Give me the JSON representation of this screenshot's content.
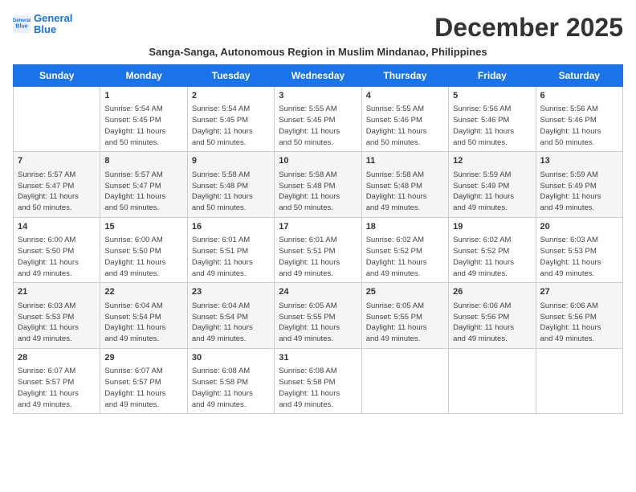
{
  "logo": {
    "text_general": "General",
    "text_blue": "Blue"
  },
  "title": "December 2025",
  "subtitle": "Sanga-Sanga, Autonomous Region in Muslim Mindanao, Philippines",
  "weekdays": [
    "Sunday",
    "Monday",
    "Tuesday",
    "Wednesday",
    "Thursday",
    "Friday",
    "Saturday"
  ],
  "weeks": [
    [
      {
        "day": "",
        "info": ""
      },
      {
        "day": "1",
        "info": "Sunrise: 5:54 AM\nSunset: 5:45 PM\nDaylight: 11 hours\nand 50 minutes."
      },
      {
        "day": "2",
        "info": "Sunrise: 5:54 AM\nSunset: 5:45 PM\nDaylight: 11 hours\nand 50 minutes."
      },
      {
        "day": "3",
        "info": "Sunrise: 5:55 AM\nSunset: 5:45 PM\nDaylight: 11 hours\nand 50 minutes."
      },
      {
        "day": "4",
        "info": "Sunrise: 5:55 AM\nSunset: 5:46 PM\nDaylight: 11 hours\nand 50 minutes."
      },
      {
        "day": "5",
        "info": "Sunrise: 5:56 AM\nSunset: 5:46 PM\nDaylight: 11 hours\nand 50 minutes."
      },
      {
        "day": "6",
        "info": "Sunrise: 5:56 AM\nSunset: 5:46 PM\nDaylight: 11 hours\nand 50 minutes."
      }
    ],
    [
      {
        "day": "7",
        "info": "Sunrise: 5:57 AM\nSunset: 5:47 PM\nDaylight: 11 hours\nand 50 minutes."
      },
      {
        "day": "8",
        "info": "Sunrise: 5:57 AM\nSunset: 5:47 PM\nDaylight: 11 hours\nand 50 minutes."
      },
      {
        "day": "9",
        "info": "Sunrise: 5:58 AM\nSunset: 5:48 PM\nDaylight: 11 hours\nand 50 minutes."
      },
      {
        "day": "10",
        "info": "Sunrise: 5:58 AM\nSunset: 5:48 PM\nDaylight: 11 hours\nand 50 minutes."
      },
      {
        "day": "11",
        "info": "Sunrise: 5:58 AM\nSunset: 5:48 PM\nDaylight: 11 hours\nand 49 minutes."
      },
      {
        "day": "12",
        "info": "Sunrise: 5:59 AM\nSunset: 5:49 PM\nDaylight: 11 hours\nand 49 minutes."
      },
      {
        "day": "13",
        "info": "Sunrise: 5:59 AM\nSunset: 5:49 PM\nDaylight: 11 hours\nand 49 minutes."
      }
    ],
    [
      {
        "day": "14",
        "info": "Sunrise: 6:00 AM\nSunset: 5:50 PM\nDaylight: 11 hours\nand 49 minutes."
      },
      {
        "day": "15",
        "info": "Sunrise: 6:00 AM\nSunset: 5:50 PM\nDaylight: 11 hours\nand 49 minutes."
      },
      {
        "day": "16",
        "info": "Sunrise: 6:01 AM\nSunset: 5:51 PM\nDaylight: 11 hours\nand 49 minutes."
      },
      {
        "day": "17",
        "info": "Sunrise: 6:01 AM\nSunset: 5:51 PM\nDaylight: 11 hours\nand 49 minutes."
      },
      {
        "day": "18",
        "info": "Sunrise: 6:02 AM\nSunset: 5:52 PM\nDaylight: 11 hours\nand 49 minutes."
      },
      {
        "day": "19",
        "info": "Sunrise: 6:02 AM\nSunset: 5:52 PM\nDaylight: 11 hours\nand 49 minutes."
      },
      {
        "day": "20",
        "info": "Sunrise: 6:03 AM\nSunset: 5:53 PM\nDaylight: 11 hours\nand 49 minutes."
      }
    ],
    [
      {
        "day": "21",
        "info": "Sunrise: 6:03 AM\nSunset: 5:53 PM\nDaylight: 11 hours\nand 49 minutes."
      },
      {
        "day": "22",
        "info": "Sunrise: 6:04 AM\nSunset: 5:54 PM\nDaylight: 11 hours\nand 49 minutes."
      },
      {
        "day": "23",
        "info": "Sunrise: 6:04 AM\nSunset: 5:54 PM\nDaylight: 11 hours\nand 49 minutes."
      },
      {
        "day": "24",
        "info": "Sunrise: 6:05 AM\nSunset: 5:55 PM\nDaylight: 11 hours\nand 49 minutes."
      },
      {
        "day": "25",
        "info": "Sunrise: 6:05 AM\nSunset: 5:55 PM\nDaylight: 11 hours\nand 49 minutes."
      },
      {
        "day": "26",
        "info": "Sunrise: 6:06 AM\nSunset: 5:56 PM\nDaylight: 11 hours\nand 49 minutes."
      },
      {
        "day": "27",
        "info": "Sunrise: 6:06 AM\nSunset: 5:56 PM\nDaylight: 11 hours\nand 49 minutes."
      }
    ],
    [
      {
        "day": "28",
        "info": "Sunrise: 6:07 AM\nSunset: 5:57 PM\nDaylight: 11 hours\nand 49 minutes."
      },
      {
        "day": "29",
        "info": "Sunrise: 6:07 AM\nSunset: 5:57 PM\nDaylight: 11 hours\nand 49 minutes."
      },
      {
        "day": "30",
        "info": "Sunrise: 6:08 AM\nSunset: 5:58 PM\nDaylight: 11 hours\nand 49 minutes."
      },
      {
        "day": "31",
        "info": "Sunrise: 6:08 AM\nSunset: 5:58 PM\nDaylight: 11 hours\nand 49 minutes."
      },
      {
        "day": "",
        "info": ""
      },
      {
        "day": "",
        "info": ""
      },
      {
        "day": "",
        "info": ""
      }
    ]
  ]
}
